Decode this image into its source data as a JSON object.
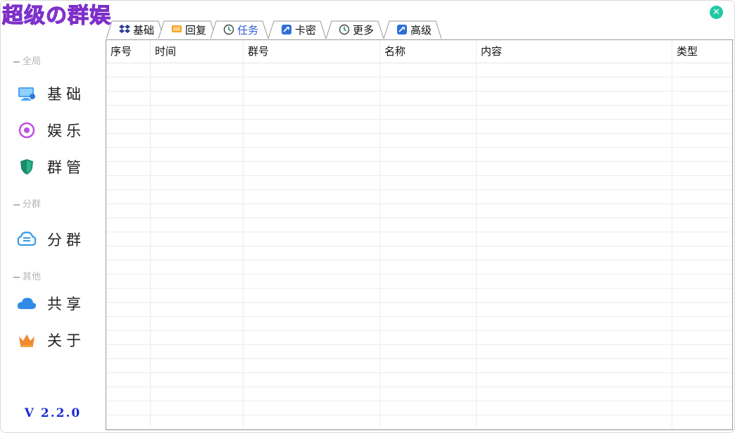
{
  "app": {
    "logo_text": "超级の群娱",
    "version": "V 2.2.0",
    "close_glyph": "✕"
  },
  "sidebar": {
    "sections": [
      {
        "title": "全局"
      },
      {
        "title": "分群"
      },
      {
        "title": "其他"
      }
    ],
    "items": [
      {
        "label": "基础",
        "icon": "monitor-icon"
      },
      {
        "label": "娱乐",
        "icon": "target-circle-icon"
      },
      {
        "label": "群管",
        "icon": "shield-icon"
      },
      {
        "label": "分群",
        "icon": "cloud-chat-icon"
      },
      {
        "label": "共享",
        "icon": "cloud-icon"
      },
      {
        "label": "关于",
        "icon": "crown-icon"
      }
    ]
  },
  "tabs": [
    {
      "label": "基础",
      "icon": "dropbox-icon"
    },
    {
      "label": "回复",
      "icon": "chat-bubble-icon"
    },
    {
      "label": "任务",
      "icon": "clock-icon",
      "active": true
    },
    {
      "label": "卡密",
      "icon": "key-card-icon"
    },
    {
      "label": "更多",
      "icon": "clock-icon"
    },
    {
      "label": "高级",
      "icon": "key-card-icon"
    }
  ],
  "table": {
    "columns": [
      "序号",
      "时间",
      "群号",
      "名称",
      "内容",
      "类型"
    ],
    "rows": []
  },
  "colors": {
    "accent": "#2f5fd0",
    "close": "#21c9a3",
    "version": "#1a2bd6"
  }
}
